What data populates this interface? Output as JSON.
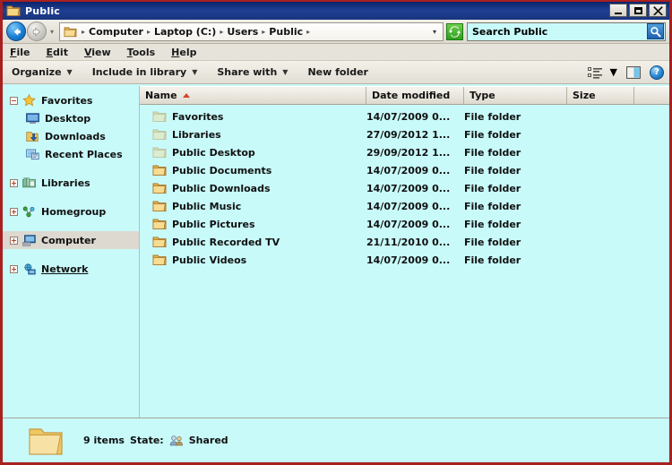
{
  "window": {
    "title": "Public",
    "title_icon": "folder-icon",
    "controls": {
      "minimize": "Minimize",
      "maximize": "Maximize",
      "close": "Close"
    }
  },
  "address_bar": {
    "back_label": "Back",
    "forward_label": "Forward",
    "history_dropdown_label": "Recent pages",
    "folder_icon": "folder-icon",
    "crumbs": [
      {
        "label": "Computer"
      },
      {
        "label": "Laptop (C:)"
      },
      {
        "label": "Users"
      },
      {
        "label": "Public"
      }
    ],
    "separator": "▸",
    "refresh_label": "Refresh",
    "refresh_icon": "refresh-icon"
  },
  "search": {
    "value": "Search Public",
    "placeholder": "Search Public",
    "icon": "search-icon"
  },
  "menu": {
    "items": [
      {
        "prefix": "",
        "accel": "F",
        "suffix": "ile"
      },
      {
        "prefix": "",
        "accel": "E",
        "suffix": "dit"
      },
      {
        "prefix": "",
        "accel": "V",
        "suffix": "iew"
      },
      {
        "prefix": "",
        "accel": "T",
        "suffix": "ools"
      },
      {
        "prefix": "",
        "accel": "H",
        "suffix": "elp"
      }
    ]
  },
  "toolbar": {
    "organize": "Organize",
    "include_in_library": "Include in library",
    "share_with": "Share with",
    "new_folder": "New folder",
    "caret": "▼",
    "view_icon": "view-options-icon",
    "view_caret": "▼",
    "preview_pane_icon": "preview-pane-icon",
    "help_icon": "help-icon",
    "help_glyph": "?"
  },
  "sidebar": {
    "groups": [
      {
        "name": "Favorites",
        "icon": "star-icon",
        "expander": "minus",
        "state": "normal",
        "children": [
          {
            "label": "Desktop",
            "icon": "desktop-icon"
          },
          {
            "label": "Downloads",
            "icon": "downloads-icon"
          },
          {
            "label": "Recent Places",
            "icon": "recent-places-icon"
          }
        ]
      },
      {
        "name": "Libraries",
        "icon": "libraries-icon",
        "expander": "plus",
        "state": "normal",
        "children": []
      },
      {
        "name": "Homegroup",
        "icon": "homegroup-icon",
        "expander": "plus",
        "state": "normal",
        "children": []
      },
      {
        "name": "Computer",
        "icon": "computer-icon",
        "expander": "plus",
        "state": "selected",
        "children": []
      },
      {
        "name": "Network",
        "icon": "network-icon",
        "expander": "plus",
        "state": "hover",
        "children": []
      }
    ]
  },
  "file_list": {
    "columns": [
      {
        "label": "Name",
        "sorted": "asc"
      },
      {
        "label": "Date modified",
        "sorted": ""
      },
      {
        "label": "Type",
        "sorted": ""
      },
      {
        "label": "Size",
        "sorted": ""
      }
    ],
    "rows": [
      {
        "name": "Favorites",
        "date": "14/07/2009 0...",
        "type": "File folder",
        "size": "",
        "icon": "folder-icon",
        "dim": true
      },
      {
        "name": "Libraries",
        "date": "27/09/2012 1...",
        "type": "File folder",
        "size": "",
        "icon": "folder-icon",
        "dim": true
      },
      {
        "name": "Public Desktop",
        "date": "29/09/2012 1...",
        "type": "File folder",
        "size": "",
        "icon": "folder-icon",
        "dim": true
      },
      {
        "name": "Public Documents",
        "date": "14/07/2009 0...",
        "type": "File folder",
        "size": "",
        "icon": "folder-icon",
        "dim": false
      },
      {
        "name": "Public Downloads",
        "date": "14/07/2009 0...",
        "type": "File folder",
        "size": "",
        "icon": "folder-icon",
        "dim": false
      },
      {
        "name": "Public Music",
        "date": "14/07/2009 0...",
        "type": "File folder",
        "size": "",
        "icon": "folder-icon",
        "dim": false
      },
      {
        "name": "Public Pictures",
        "date": "14/07/2009 0...",
        "type": "File folder",
        "size": "",
        "icon": "folder-icon",
        "dim": false
      },
      {
        "name": "Public Recorded TV",
        "date": "21/11/2010 0...",
        "type": "File folder",
        "size": "",
        "icon": "folder-icon",
        "dim": false
      },
      {
        "name": "Public Videos",
        "date": "14/07/2009 0...",
        "type": "File folder",
        "size": "",
        "icon": "folder-icon",
        "dim": false
      }
    ]
  },
  "status_bar": {
    "folder_icon": "folder-icon",
    "item_count": "9 items",
    "state_label": "State:",
    "state_icon": "shared-users-icon",
    "state_value": "Shared"
  },
  "colors": {
    "titlebar": "#16357e",
    "window_border": "#a82020",
    "content_bg": "#c8fafa",
    "chrome_bg": "#e6e3db",
    "sort_marker": "#d1442a",
    "selection": "#ddd9d0"
  }
}
